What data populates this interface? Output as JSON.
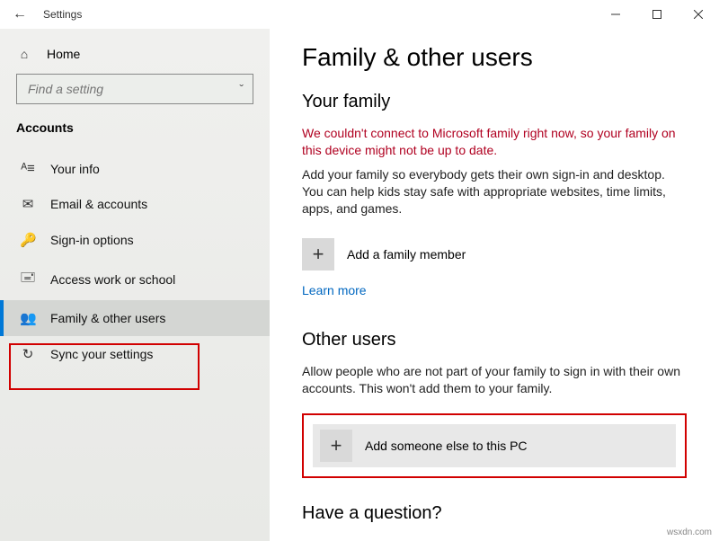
{
  "titlebar": {
    "app_title": "Settings"
  },
  "sidebar": {
    "home_label": "Home",
    "search_placeholder": "Find a setting",
    "section_label": "Accounts",
    "items": [
      {
        "icon_name": "user-icon",
        "glyph": "ᴬ≡",
        "label": "Your info"
      },
      {
        "icon_name": "email-icon",
        "glyph": "✉",
        "label": "Email & accounts"
      },
      {
        "icon_name": "key-icon",
        "glyph": "🔑",
        "label": "Sign-in options"
      },
      {
        "icon_name": "briefcase-icon",
        "glyph": "🖃",
        "label": "Access work or school"
      },
      {
        "icon_name": "family-icon",
        "glyph": "👥",
        "label": "Family & other users"
      },
      {
        "icon_name": "sync-icon",
        "glyph": "↻",
        "label": "Sync your settings"
      }
    ]
  },
  "content": {
    "page_title": "Family & other users",
    "family_heading": "Your family",
    "error_text": "We couldn't connect to Microsoft family right now, so your family on this device might not be up to date.",
    "family_body": "Add your family so everybody gets their own sign-in and desktop. You can help kids stay safe with appropriate websites, time limits, apps, and games.",
    "add_family_label": "Add a family member",
    "learn_more": "Learn more",
    "other_heading": "Other users",
    "other_body": "Allow people who are not part of your family to sign in with their own accounts. This won't add them to your family.",
    "add_other_label": "Add someone else to this PC",
    "question_heading": "Have a question?"
  },
  "watermark": "wsxdn.com"
}
